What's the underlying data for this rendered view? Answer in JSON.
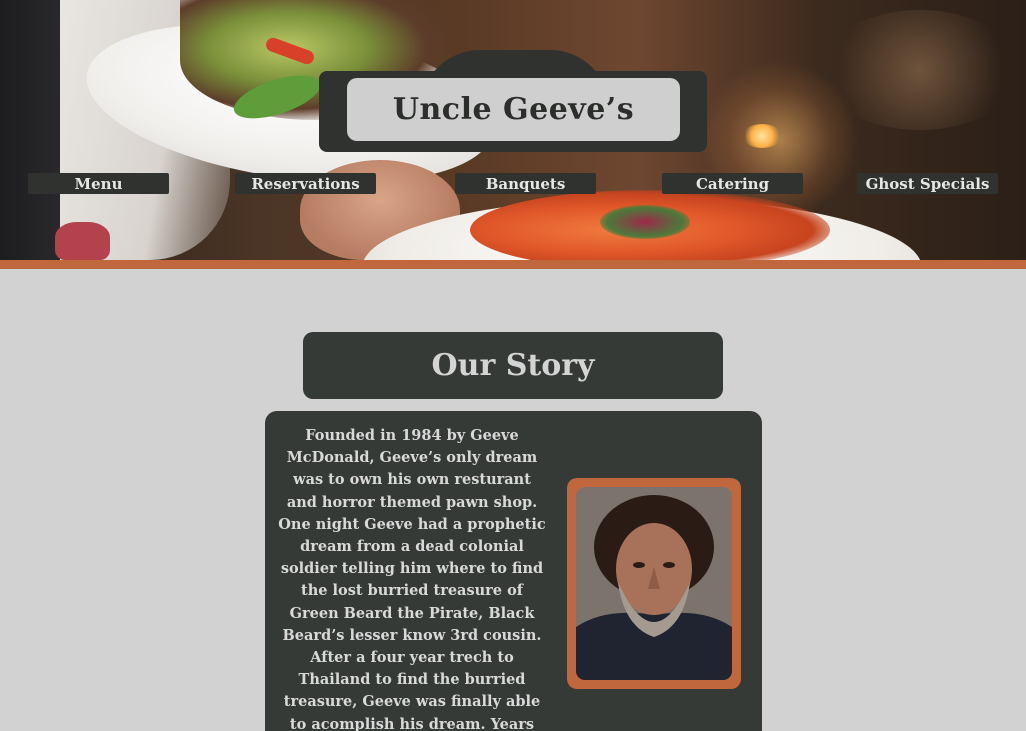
{
  "site": {
    "brand": "Uncle Geeve’s"
  },
  "nav": {
    "items": [
      {
        "label": "Menu"
      },
      {
        "label": "Reservations"
      },
      {
        "label": "Banquets"
      },
      {
        "label": "Catering"
      },
      {
        "label": "Ghost Specials"
      }
    ]
  },
  "story": {
    "heading": "Our Story",
    "body": "Founded in 1984 by Geeve McDonald, Geeve’s only dream was to own his own resturant and horror themed pawn shop. One night Geeve had a prophetic dream from a dead colonial soldier telling him where to find the lost burried treasure of Green Beard the Pirate, Black Beard’s lesser know 3rd cousin. After a four year trech to Thailand to find the burried treasure, Geeve was finally able to acomplish his dream. Years after Geeve’s death"
  },
  "colors": {
    "dark": "#353a36",
    "accent": "#c0673e",
    "background": "#d2d2d2",
    "light": "#cfcfcf"
  }
}
